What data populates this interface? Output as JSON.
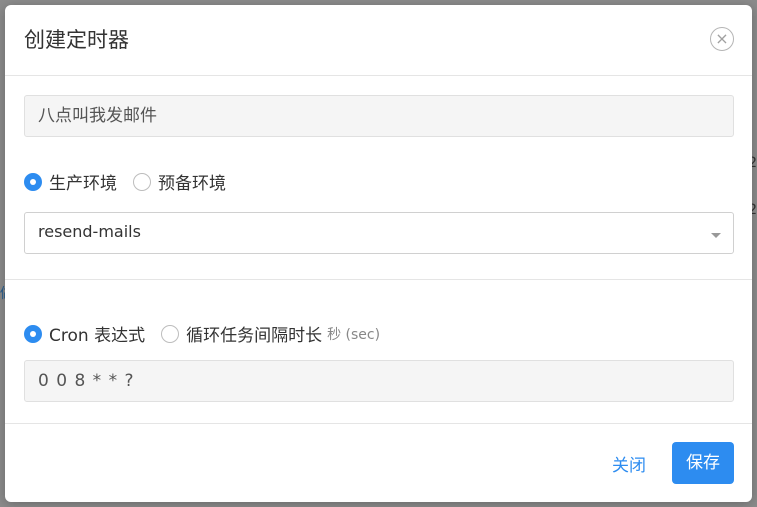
{
  "background": {
    "left_char": "做",
    "right_char_1": "2",
    "right_char_2": "2"
  },
  "dialog": {
    "title": "创建定时器",
    "close_icon": "×"
  },
  "form": {
    "name_value": "八点叫我发邮件",
    "environment": {
      "options": [
        {
          "label": "生产环境",
          "checked": true
        },
        {
          "label": "预备环境",
          "checked": false
        }
      ]
    },
    "task_select_value": "resend-mails",
    "schedule": {
      "options": [
        {
          "label": "Cron 表达式",
          "checked": true
        },
        {
          "label": "循环任务间隔时长",
          "checked": false
        }
      ],
      "interval_hint": "秒 (sec)"
    },
    "cron_value": "0 0 8 * * ?"
  },
  "footer": {
    "close_label": "关闭",
    "save_label": "保存"
  },
  "colors": {
    "accent": "#2d8cf0",
    "overlay": "#8c8c8c"
  }
}
